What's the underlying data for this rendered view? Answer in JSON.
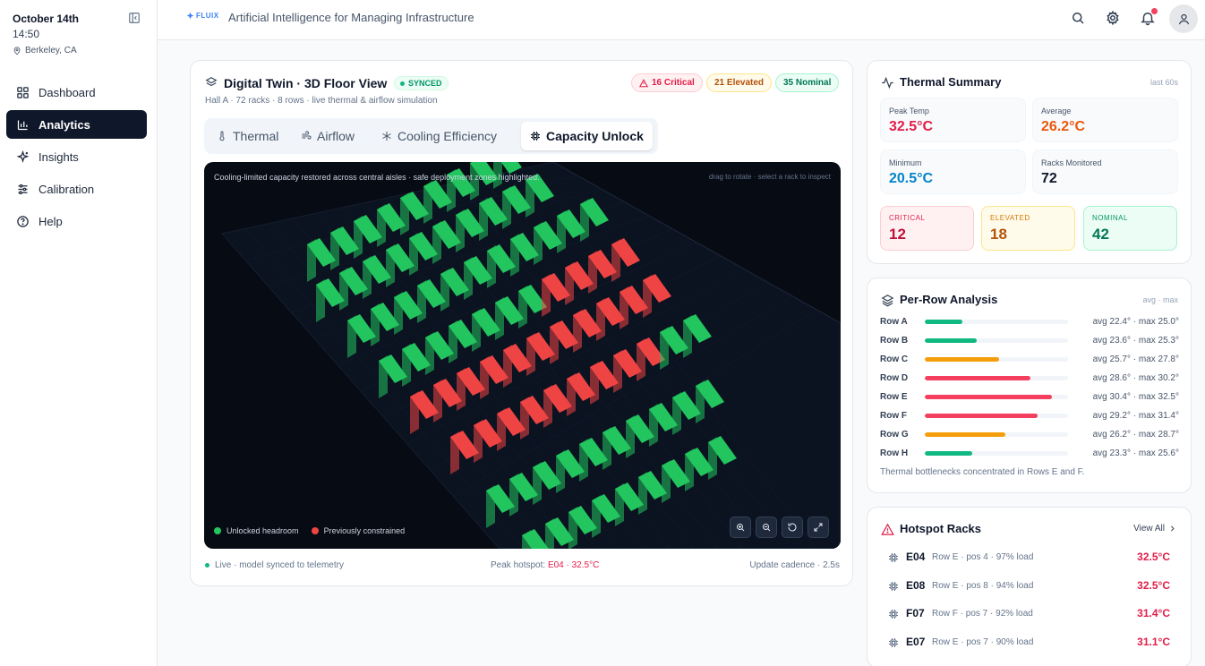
{
  "sidebar": {
    "date": "October 14th",
    "time": "14:50",
    "location": "Berkeley, CA",
    "nav": [
      {
        "label": "Dashboard",
        "icon": "grid-icon",
        "active": false
      },
      {
        "label": "Analytics",
        "icon": "bar-chart-icon",
        "active": true
      },
      {
        "label": "Insights",
        "icon": "sparkle-icon",
        "active": false
      },
      {
        "label": "Calibration",
        "icon": "sliders-icon",
        "active": false
      },
      {
        "label": "Help",
        "icon": "help-icon",
        "active": false
      }
    ]
  },
  "header": {
    "logo": "FLUIX",
    "tagline": "Artificial Intelligence for Managing Infrastructure"
  },
  "main": {
    "title": "Digital Twin · 3D Floor View",
    "status": "SYNCED",
    "subtitle": "Hall A · 72 racks · 8 rows · live thermal & airflow simulation",
    "badges": {
      "critical": "16 Critical",
      "elevated": "21 Elevated",
      "nominal": "35 Nominal"
    },
    "tabs": [
      {
        "label": "Thermal",
        "icon": "thermometer-icon"
      },
      {
        "label": "Airflow",
        "icon": "wind-icon"
      },
      {
        "label": "Cooling Efficiency",
        "icon": "snowflake-icon"
      },
      {
        "label": "Capacity Unlock",
        "icon": "chip-icon",
        "active": true
      }
    ],
    "viz_note": "Cooling-limited capacity restored across central aisles · safe deployment zones highlighted.",
    "viz_hint": "drag to rotate · select a rack to inspect",
    "legend": {
      "unlocked": "Unlocked headroom",
      "constrained": "Previously constrained"
    },
    "colors": {
      "unlocked": "#22c55e",
      "constrained": "#ef4444"
    },
    "footer": {
      "live": "Live · model synced to telemetry",
      "peak_label": "Peak hotspot:",
      "peak_value": "E04 · 32.5°C",
      "cadence": "Update cadence · 2.5s"
    }
  },
  "thermal_summary": {
    "title": "Thermal Summary",
    "meta": "last 60s",
    "peak": {
      "label": "Peak Temp",
      "value": "32.5°C",
      "color": "#e11d48"
    },
    "average": {
      "label": "Average",
      "value": "26.2°C",
      "color": "#ea580c"
    },
    "minimum": {
      "label": "Minimum",
      "value": "20.5°C",
      "color": "#0284c7"
    },
    "racks": {
      "label": "Racks Monitored",
      "value": "72",
      "color": "#0f172a"
    },
    "critical": {
      "label": "CRITICAL",
      "value": "12"
    },
    "elevated": {
      "label": "ELEVATED",
      "value": "18"
    },
    "nominal": {
      "label": "NOMINAL",
      "value": "42"
    }
  },
  "per_row": {
    "title": "Per-Row Analysis",
    "meta": "avg · max",
    "rows": [
      {
        "name": "Row A",
        "text": "avg 22.4° · max 25.0°",
        "fill": 0.26,
        "color": "#10b981"
      },
      {
        "name": "Row B",
        "text": "avg 23.6° · max 25.3°",
        "fill": 0.36,
        "color": "#10b981"
      },
      {
        "name": "Row C",
        "text": "avg 25.7° · max 27.8°",
        "fill": 0.52,
        "color": "#f59e0b"
      },
      {
        "name": "Row D",
        "text": "avg 28.6° · max 30.2°",
        "fill": 0.74,
        "color": "#f43f5e"
      },
      {
        "name": "Row E",
        "text": "avg 30.4° · max 32.5°",
        "fill": 0.89,
        "color": "#f43f5e"
      },
      {
        "name": "Row F",
        "text": "avg 29.2° · max 31.4°",
        "fill": 0.79,
        "color": "#f43f5e"
      },
      {
        "name": "Row G",
        "text": "avg 26.2° · max 28.7°",
        "fill": 0.56,
        "color": "#f59e0b"
      },
      {
        "name": "Row H",
        "text": "avg 23.3° · max 25.6°",
        "fill": 0.33,
        "color": "#10b981"
      }
    ],
    "note": "Thermal bottlenecks concentrated in Rows E and F."
  },
  "hotspots": {
    "title": "Hotspot Racks",
    "view_all": "View All",
    "items": [
      {
        "id": "E04",
        "meta": "Row E · pos 4 · 97% load",
        "temp": "32.5°C"
      },
      {
        "id": "E08",
        "meta": "Row E · pos 8 · 94% load",
        "temp": "32.5°C"
      },
      {
        "id": "F07",
        "meta": "Row F · pos 7 · 92% load",
        "temp": "31.4°C"
      },
      {
        "id": "E07",
        "meta": "Row E · pos 7 · 90% load",
        "temp": "31.1°C"
      }
    ]
  }
}
